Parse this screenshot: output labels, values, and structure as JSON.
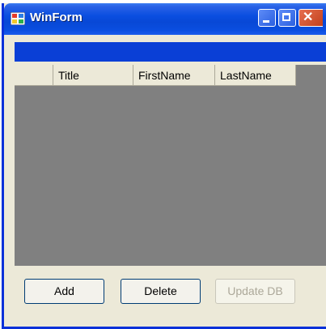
{
  "window": {
    "title": "WinForm"
  },
  "grid": {
    "columns": [
      "Title",
      "FirstName",
      "LastName"
    ]
  },
  "buttons": {
    "add": "Add",
    "delete": "Delete",
    "update": "Update DB"
  },
  "icons": {
    "app": "app-icon",
    "minimize": "minimize-icon",
    "maximize": "maximize-icon",
    "close": "close-icon"
  }
}
